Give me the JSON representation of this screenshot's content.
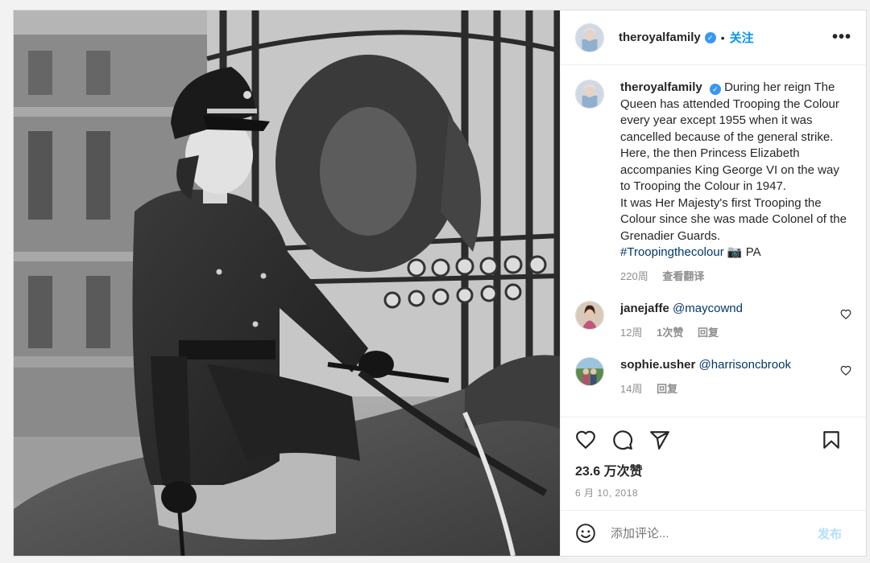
{
  "header": {
    "username": "theroyalfamily",
    "follow_label": "关注",
    "more_label": "•••"
  },
  "caption": {
    "username": "theroyalfamily",
    "text": "During her reign The Queen has attended Trooping the Colour every year except 1955 when it was cancelled because of the general strike. Here, the then Princess Elizabeth accompanies King George VI on the way to Trooping the Colour in 1947.",
    "text2": "It was Her Majesty's first Trooping the Colour since she was made Colonel of the Grenadier Guards.",
    "hashtag": "#Troopingthecolour",
    "credit": "📷 PA",
    "age": "220周",
    "translate_label": "查看翻译"
  },
  "comments": [
    {
      "username": "janejaffe",
      "mention": "@maycownd",
      "age": "12周",
      "likes": "1次赞",
      "reply_label": "回复"
    },
    {
      "username": "sophie.usher",
      "mention": "@harrisoncbrook",
      "age": "14周",
      "reply_label": "回复"
    }
  ],
  "post": {
    "likes": "23.6 万次赞",
    "date": "6 月 10, 2018"
  },
  "add_comment": {
    "placeholder": "添加评论...",
    "post_label": "发布"
  },
  "icons": [
    "heart-icon",
    "comment-icon",
    "share-icon",
    "bookmark-icon",
    "emoji-icon",
    "verified-badge",
    "more-icon"
  ],
  "colors": {
    "accent": "#0095f6",
    "link": "#00376b",
    "verified": "#3897f0",
    "muted": "#8e8e8e",
    "post_disabled": "#b2dffc"
  }
}
